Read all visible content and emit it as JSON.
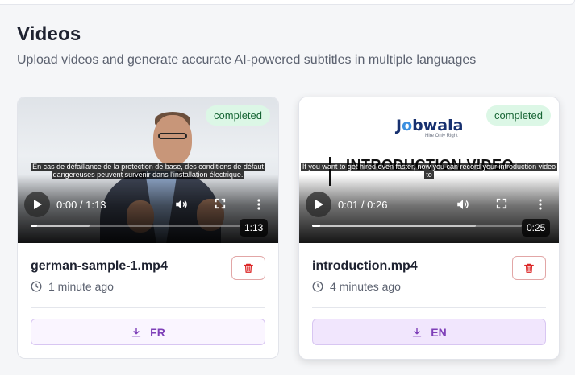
{
  "page": {
    "title": "Videos",
    "subtitle": "Upload videos and generate accurate AI-powered subtitles in multiple languages"
  },
  "videos": [
    {
      "status": "completed",
      "subtitle_line_1": "En cas de défaillance de la protection de base, des conditions de défaut",
      "subtitle_line_2": "dangereuses peuvent survenir dans l'installation électrique.",
      "time_display": "0:00 / 1:13",
      "duration_badge": "1:13",
      "progress_fraction": 0,
      "file_name": "german-sample-1.mp4",
      "uploaded_ago": "1 minute ago",
      "language": "FR"
    },
    {
      "status": "completed",
      "logo_text_a": "J",
      "logo_text_b": "o",
      "logo_text_c": "bwala",
      "logo_tagline": "Hire Only Right",
      "frame_title": "INTRODUCTION VIDEO",
      "subtitle_line_1": "If you want to get hired even faster, now you can record your introduction video",
      "subtitle_line_2": "to",
      "time_display": "0:01 / 0:26",
      "duration_badge": "0:25",
      "progress_fraction": 0.04,
      "file_name": "introduction.mp4",
      "uploaded_ago": "4 minutes ago",
      "language": "EN"
    }
  ],
  "colors": {
    "badge_bg": "#dcf7e6",
    "badge_text": "#166534",
    "delete_red": "#dc2626",
    "language_purple": "#7e3fb8"
  },
  "icons": [
    "play-icon",
    "volume-icon",
    "fullscreen-icon",
    "more-vertical-icon",
    "clock-icon",
    "trash-icon",
    "download-icon"
  ]
}
